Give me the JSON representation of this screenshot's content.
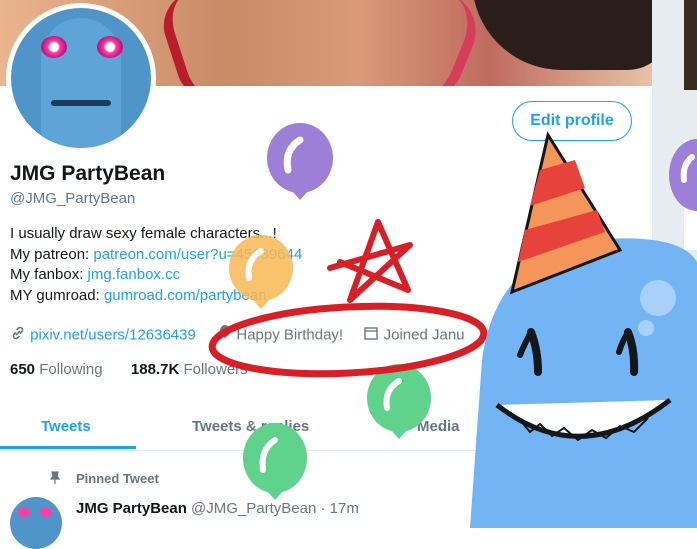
{
  "profile": {
    "display_name": "JMG PartyBean",
    "handle": "@JMG_PartyBean",
    "edit_button": "Edit profile",
    "bio_line1": "I usually draw sexy female characters...!",
    "bio_patreon_label": "My patreon: ",
    "bio_patreon_link": "patreon.com/user?u=45939644",
    "bio_fanbox_label": "My fanbox: ",
    "bio_fanbox_link": "jmg.fanbox.cc",
    "bio_gumroad_label": "MY gumroad: ",
    "bio_gumroad_link": "gumroad.com/partybean",
    "website": "pixiv.net/users/12636439",
    "birthday": "Happy Birthday!",
    "joined": "Joined Janu",
    "following_count": "650",
    "following_label": "Following",
    "followers_count": "188.7K",
    "followers_label": "Followers"
  },
  "tabs": [
    {
      "label": "Tweets"
    },
    {
      "label": "Tweets & replies"
    },
    {
      "label": "Media"
    }
  ],
  "pinned": {
    "label": "Pinned Tweet",
    "author": "JMG PartyBean",
    "handle": "@JMG_PartyBean",
    "time": "· 17m"
  },
  "icons": {
    "website": "link-icon",
    "birthday": "balloon-icon",
    "joined": "calendar-icon",
    "pinned": "pin-icon"
  },
  "colors": {
    "accent": "#1da1f2",
    "secondary_text": "#657786",
    "balloon_purple": "#9d7fd8",
    "balloon_orange": "#f9b955",
    "balloon_green": "#5fd38b",
    "mascot_blue": "#73b5f4",
    "annotation_red": "#d81f26"
  }
}
